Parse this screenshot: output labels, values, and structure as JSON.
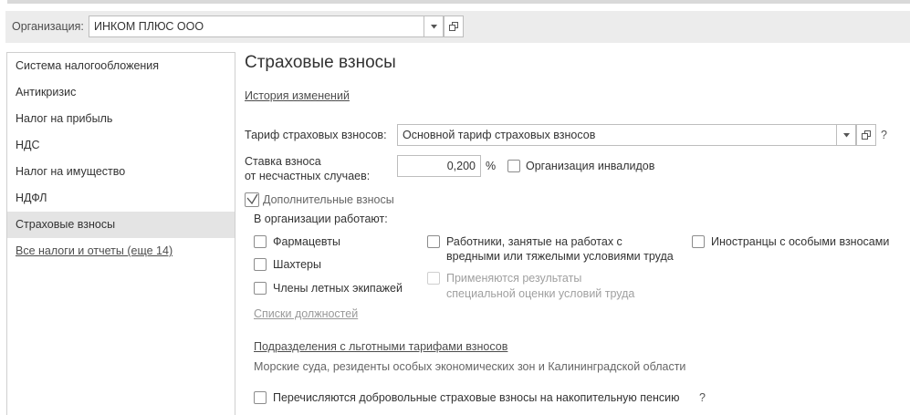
{
  "org": {
    "label": "Организация:",
    "value": "ИНКОМ ПЛЮС ООО"
  },
  "sidebar": {
    "items": [
      {
        "label": "Система налогообложения",
        "active": false
      },
      {
        "label": "Антикризис",
        "active": false
      },
      {
        "label": "Налог на прибыль",
        "active": false
      },
      {
        "label": "НДС",
        "active": false
      },
      {
        "label": "Налог на имущество",
        "active": false
      },
      {
        "label": "НДФЛ",
        "active": false
      },
      {
        "label": "Страховые взносы",
        "active": true
      }
    ],
    "more_link": "Все налоги и отчеты (еще 14)"
  },
  "main": {
    "title": "Страховые взносы",
    "history_link": "История изменений",
    "tariff": {
      "label": "Тариф страховых взносов:",
      "value": "Основной тариф страховых взносов",
      "help": "?"
    },
    "rate": {
      "label_line1": "Ставка взноса",
      "label_line2": "от несчастных случаев:",
      "value": "0,200",
      "unit": "%"
    },
    "disabled_org": {
      "label": "Организация инвалидов",
      "checked": false
    },
    "additional": {
      "label": "Дополнительные взносы",
      "checked": true
    },
    "works_label": "В организации работают:",
    "checkboxes": {
      "pharmacists": {
        "label": "Фармацевты",
        "checked": false
      },
      "miners": {
        "label": "Шахтеры",
        "checked": false
      },
      "flight_crew": {
        "label": "Члены летных экипажей",
        "checked": false
      },
      "hazardous_line1": "Работники, занятые на работах с",
      "hazardous_line2": "вредными или тяжелыми условиями труда",
      "assessment_line1": "Применяются результаты",
      "assessment_line2": "специальной оценки условий труда",
      "foreigners": {
        "label": "Иностранцы с особыми взносами",
        "checked": false
      }
    },
    "positions_link": "Списки должностей",
    "divisions_link": "Подразделения с льготными тарифами взносов",
    "divisions_text": "Морские суда, резиденты особых экономических зон и Калининградской области",
    "voluntary": {
      "label": "Перечисляются добровольные страховые взносы на накопительную пенсию",
      "help": "?",
      "checked": false
    }
  },
  "icons": {
    "dropdown": "triangle-down-icon",
    "open": "open-window-icon",
    "check": "checkmark-icon"
  }
}
